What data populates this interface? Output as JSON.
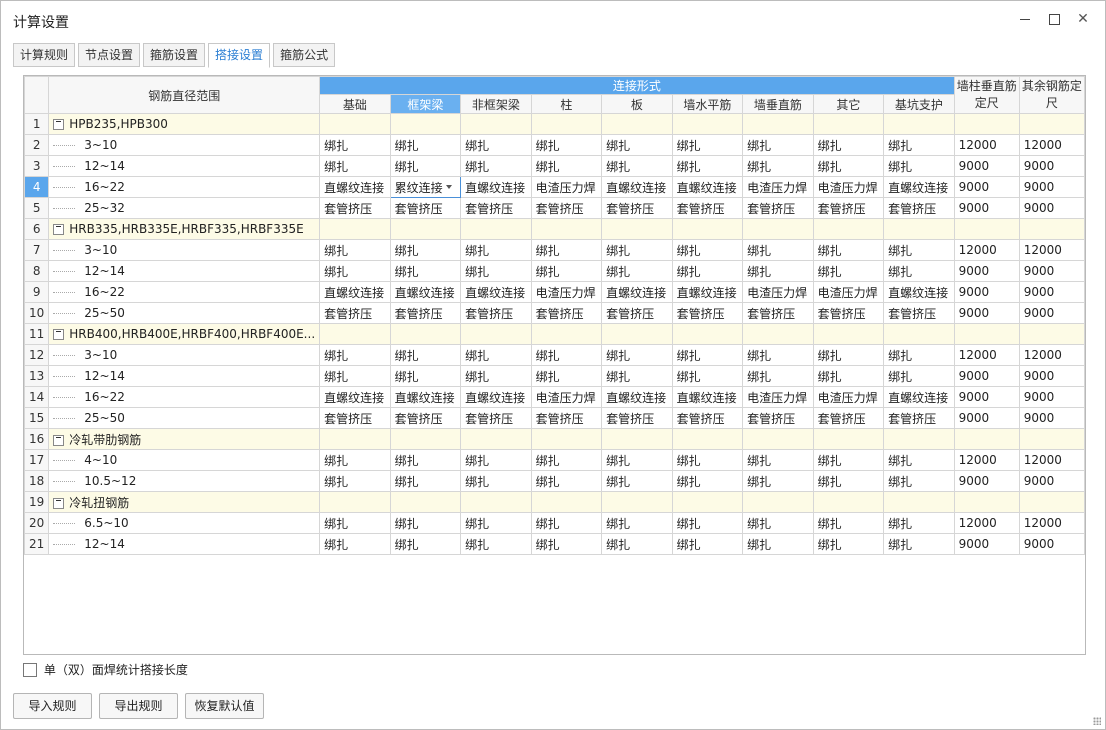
{
  "window": {
    "title": "计算设置",
    "controls": {
      "minimize": "minimize-icon",
      "maximize": "maximize-icon",
      "close": "close-icon"
    }
  },
  "tabs": [
    {
      "label": "计算规则",
      "active": false
    },
    {
      "label": "节点设置",
      "active": false
    },
    {
      "label": "箍筋设置",
      "active": false
    },
    {
      "label": "搭接设置",
      "active": true
    },
    {
      "label": "箍筋公式",
      "active": false
    }
  ],
  "grid": {
    "header": {
      "range": "钢筋直径范围",
      "connection_group": "连接形式",
      "connection_cols": [
        "基础",
        "框架梁",
        "非框架梁",
        "柱",
        "板",
        "墙水平筋",
        "墙垂直筋",
        "其它",
        "基坑支护"
      ],
      "wall_col_fixed": "墙柱垂直筋定尺",
      "other_fixed": "其余钢筋定尺"
    },
    "selected_column": 1,
    "selected_row": 4,
    "rows": [
      {
        "num": "1",
        "type": "group",
        "label": "HPB235,HPB300"
      },
      {
        "num": "2",
        "type": "item",
        "label": "3~10",
        "cells": [
          "绑扎",
          "绑扎",
          "绑扎",
          "绑扎",
          "绑扎",
          "绑扎",
          "绑扎",
          "绑扎",
          "绑扎",
          "12000",
          "12000"
        ]
      },
      {
        "num": "3",
        "type": "item",
        "label": "12~14",
        "cells": [
          "绑扎",
          "绑扎",
          "绑扎",
          "绑扎",
          "绑扎",
          "绑扎",
          "绑扎",
          "绑扎",
          "绑扎",
          "9000",
          "9000"
        ]
      },
      {
        "num": "4",
        "type": "item",
        "label": "16~22",
        "cells": [
          "直螺纹连接",
          "累纹连接",
          "直螺纹连接",
          "电渣压力焊",
          "直螺纹连接",
          "直螺纹连接",
          "电渣压力焊",
          "电渣压力焊",
          "直螺纹连接",
          "9000",
          "9000"
        ]
      },
      {
        "num": "5",
        "type": "item",
        "label": "25~32",
        "cells": [
          "套管挤压",
          "套管挤压",
          "套管挤压",
          "套管挤压",
          "套管挤压",
          "套管挤压",
          "套管挤压",
          "套管挤压",
          "套管挤压",
          "9000",
          "9000"
        ]
      },
      {
        "num": "6",
        "type": "group",
        "label": "HRB335,HRB335E,HRBF335,HRBF335E"
      },
      {
        "num": "7",
        "type": "item",
        "label": "3~10",
        "cells": [
          "绑扎",
          "绑扎",
          "绑扎",
          "绑扎",
          "绑扎",
          "绑扎",
          "绑扎",
          "绑扎",
          "绑扎",
          "12000",
          "12000"
        ]
      },
      {
        "num": "8",
        "type": "item",
        "label": "12~14",
        "cells": [
          "绑扎",
          "绑扎",
          "绑扎",
          "绑扎",
          "绑扎",
          "绑扎",
          "绑扎",
          "绑扎",
          "绑扎",
          "9000",
          "9000"
        ]
      },
      {
        "num": "9",
        "type": "item",
        "label": "16~22",
        "cells": [
          "直螺纹连接",
          "直螺纹连接",
          "直螺纹连接",
          "电渣压力焊",
          "直螺纹连接",
          "直螺纹连接",
          "电渣压力焊",
          "电渣压力焊",
          "直螺纹连接",
          "9000",
          "9000"
        ]
      },
      {
        "num": "10",
        "type": "item",
        "label": "25~50",
        "cells": [
          "套管挤压",
          "套管挤压",
          "套管挤压",
          "套管挤压",
          "套管挤压",
          "套管挤压",
          "套管挤压",
          "套管挤压",
          "套管挤压",
          "9000",
          "9000"
        ]
      },
      {
        "num": "11",
        "type": "group",
        "label": "HRB400,HRB400E,HRBF400,HRBF400E..."
      },
      {
        "num": "12",
        "type": "item",
        "label": "3~10",
        "cells": [
          "绑扎",
          "绑扎",
          "绑扎",
          "绑扎",
          "绑扎",
          "绑扎",
          "绑扎",
          "绑扎",
          "绑扎",
          "12000",
          "12000"
        ]
      },
      {
        "num": "13",
        "type": "item",
        "label": "12~14",
        "cells": [
          "绑扎",
          "绑扎",
          "绑扎",
          "绑扎",
          "绑扎",
          "绑扎",
          "绑扎",
          "绑扎",
          "绑扎",
          "9000",
          "9000"
        ]
      },
      {
        "num": "14",
        "type": "item",
        "label": "16~22",
        "cells": [
          "直螺纹连接",
          "直螺纹连接",
          "直螺纹连接",
          "电渣压力焊",
          "直螺纹连接",
          "直螺纹连接",
          "电渣压力焊",
          "电渣压力焊",
          "直螺纹连接",
          "9000",
          "9000"
        ]
      },
      {
        "num": "15",
        "type": "item",
        "label": "25~50",
        "cells": [
          "套管挤压",
          "套管挤压",
          "套管挤压",
          "套管挤压",
          "套管挤压",
          "套管挤压",
          "套管挤压",
          "套管挤压",
          "套管挤压",
          "9000",
          "9000"
        ]
      },
      {
        "num": "16",
        "type": "group",
        "label": "冷轧带肋钢筋"
      },
      {
        "num": "17",
        "type": "item",
        "label": "4~10",
        "cells": [
          "绑扎",
          "绑扎",
          "绑扎",
          "绑扎",
          "绑扎",
          "绑扎",
          "绑扎",
          "绑扎",
          "绑扎",
          "12000",
          "12000"
        ]
      },
      {
        "num": "18",
        "type": "item",
        "label": "10.5~12",
        "cells": [
          "绑扎",
          "绑扎",
          "绑扎",
          "绑扎",
          "绑扎",
          "绑扎",
          "绑扎",
          "绑扎",
          "绑扎",
          "9000",
          "9000"
        ]
      },
      {
        "num": "19",
        "type": "group",
        "label": "冷轧扭钢筋"
      },
      {
        "num": "20",
        "type": "item",
        "label": "6.5~10",
        "cells": [
          "绑扎",
          "绑扎",
          "绑扎",
          "绑扎",
          "绑扎",
          "绑扎",
          "绑扎",
          "绑扎",
          "绑扎",
          "12000",
          "12000"
        ]
      },
      {
        "num": "21",
        "type": "item",
        "label": "12~14",
        "cells": [
          "绑扎",
          "绑扎",
          "绑扎",
          "绑扎",
          "绑扎",
          "绑扎",
          "绑扎",
          "绑扎",
          "绑扎",
          "9000",
          "9000"
        ]
      }
    ]
  },
  "checkbox": {
    "label": "单（双）面焊统计搭接长度",
    "checked": false
  },
  "buttons": {
    "import": "导入规则",
    "export": "导出规则",
    "restore": "恢复默认值"
  },
  "colors": {
    "accent": "#5aa6ec",
    "group_row_bg": "#fdfbe6",
    "active_tab_text": "#2a7ed3"
  }
}
